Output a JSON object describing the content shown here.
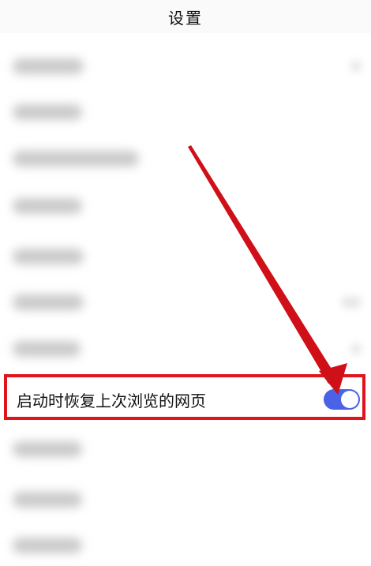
{
  "header": {
    "title": "设置"
  },
  "settings": {
    "highlighted_item": {
      "label": "启动时恢复上次浏览的网页",
      "toggle_state": "on"
    }
  },
  "colors": {
    "toggle_on": "#4a62e6",
    "highlight_border": "#e0141b",
    "arrow": "#d01018"
  },
  "icons": {
    "annotation": "red-arrow-pointer"
  }
}
